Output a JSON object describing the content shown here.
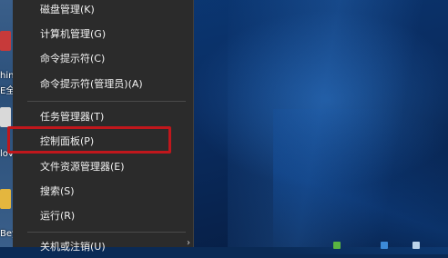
{
  "desktop": {
    "icon_texts": [
      "hin",
      "E全",
      "lov",
      "Beyo"
    ]
  },
  "menu": {
    "items": [
      {
        "label": "磁盘管理(K)"
      },
      {
        "label": "计算机管理(G)"
      },
      {
        "label": "命令提示符(C)"
      },
      {
        "label": "命令提示符(管理员)(A)"
      },
      {
        "label": "任务管理器(T)"
      },
      {
        "label": "控制面板(P)"
      },
      {
        "label": "文件资源管理器(E)"
      },
      {
        "label": "搜索(S)"
      },
      {
        "label": "运行(R)"
      },
      {
        "label": "关机或注销(U)"
      }
    ],
    "submenu_arrow": "›"
  }
}
